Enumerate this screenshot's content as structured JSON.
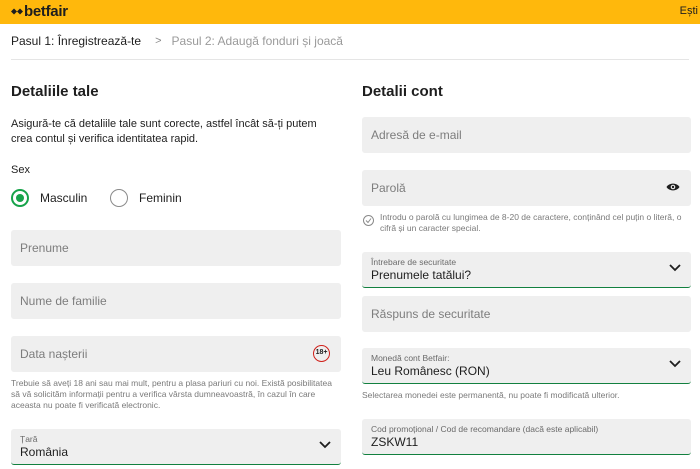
{
  "header": {
    "logo_text": "betfair",
    "right_text": "Ești",
    "brand_color": "#ffb80c"
  },
  "steps": {
    "step1": "Pasul 1: Înregistrează-te",
    "step2": "Pasul 2: Adaugă fonduri și joacă"
  },
  "left": {
    "title": "Detaliile tale",
    "intro": "Asigură-te că detaliile tale sunt corecte, astfel încât să-ți putem crea contul și verifica identitatea rapid.",
    "sex_label": "Sex",
    "sex_options": [
      "Masculin",
      "Feminin"
    ],
    "sex_selected": "Masculin",
    "first_name_placeholder": "Prenume",
    "last_name_placeholder": "Nume de familie",
    "dob_placeholder": "Data nașterii",
    "age_badge": "18+",
    "age_note": "Trebuie să aveți 18 ani sau mai mult, pentru a plasa pariuri cu noi. Există posibilitatea să vă solicităm informații pentru a verifica vârsta dumneavoastră, în cazul în care aceasta nu poate fi verificată electronic.",
    "country_label": "Țară",
    "country_value": "România"
  },
  "right": {
    "title": "Detalii cont",
    "email_placeholder": "Adresă de e-mail",
    "password_placeholder": "Parolă",
    "password_hint": "Introdu o parolă cu lungimea de 8-20 de caractere, conținând cel puțin o literă, o cifră și un caracter special.",
    "security_question_label": "Întrebare de securitate",
    "security_question_value": "Prenumele tatălui?",
    "security_answer_placeholder": "Răspuns de securitate",
    "currency_label": "Monedă cont Betfair:",
    "currency_value": "Leu Românesc (RON)",
    "currency_note": "Selectarea monedei este permanentă, nu poate fi modificată ulterior.",
    "promo_label": "Cod promoțional / Cod de recomandare (dacă este aplicabil)",
    "promo_value": "ZSKW11"
  },
  "icons": [
    "betfair-logo-icon",
    "chevron-right-icon",
    "chevron-down-icon",
    "eye-icon",
    "info-check-icon",
    "age-18-icon"
  ],
  "colors": {
    "accent_green": "#17a34a",
    "field_bg": "#efefef",
    "age_red": "#d0201a"
  }
}
